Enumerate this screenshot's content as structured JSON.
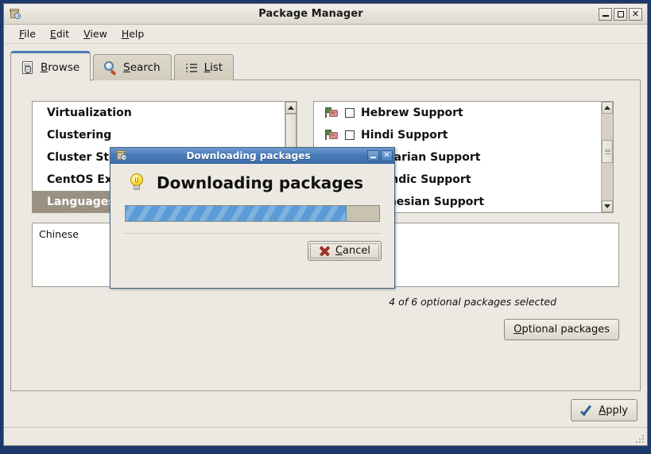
{
  "window": {
    "title": "Package Manager",
    "icon": "package-icon",
    "controls": {
      "minimize": "minimize-icon",
      "maximize": "maximize-icon",
      "close": "close-icon"
    }
  },
  "menubar": [
    {
      "label": "File",
      "mnemonic": "F"
    },
    {
      "label": "Edit",
      "mnemonic": "E"
    },
    {
      "label": "View",
      "mnemonic": "V"
    },
    {
      "label": "Help",
      "mnemonic": "H"
    }
  ],
  "tabs": [
    {
      "label": "Browse",
      "mnemonic": "B",
      "icon": "browse-icon",
      "active": true
    },
    {
      "label": "Search",
      "mnemonic": "S",
      "icon": "search-icon",
      "active": false
    },
    {
      "label": "List",
      "mnemonic": "L",
      "icon": "list-icon",
      "active": false
    }
  ],
  "left_list": {
    "items": [
      {
        "label": "Virtualization",
        "selected": false
      },
      {
        "label": "Clustering",
        "selected": false
      },
      {
        "label": "Cluster Storage",
        "selected": false
      },
      {
        "label": "CentOS Extras",
        "selected": false
      },
      {
        "label": "Languages",
        "selected": true
      }
    ]
  },
  "right_list": {
    "items": [
      {
        "label": "Hebrew Support",
        "checked": false,
        "icon": "language-flag-icon"
      },
      {
        "label": "Hindi Support",
        "checked": false,
        "icon": "language-flag-icon"
      },
      {
        "label": "Hungarian Support",
        "checked": false,
        "icon": "language-flag-icon"
      },
      {
        "label": "Icelandic Support",
        "checked": false,
        "icon": "language-flag-icon"
      },
      {
        "label": "Indonesian Support",
        "checked": false,
        "icon": "language-flag-icon"
      }
    ]
  },
  "description": {
    "text": "Chinese"
  },
  "optional": {
    "status": "4 of 6 optional packages selected",
    "button_label": "Optional packages",
    "button_mnemonic": "O"
  },
  "apply": {
    "label": "Apply",
    "mnemonic": "A",
    "icon": "checkmark-icon"
  },
  "dialog": {
    "titlebar": "Downloading packages",
    "heading": "Downloading packages",
    "icon": "lightbulb-icon",
    "progress_percent": 87,
    "cancel": {
      "label": "Cancel",
      "mnemonic": "C",
      "icon": "red-x-icon"
    },
    "controls": {
      "minimize": "minimize-icon",
      "close": "close-icon"
    }
  },
  "colors": {
    "desktop": "#1b3a6b",
    "window_bg": "#ece9e2",
    "dialog_title": "#4a7cb8",
    "active_tab_accent": "#4a7ab5",
    "selection": "#9a9183",
    "progress_fill": "#5b9bd9"
  }
}
